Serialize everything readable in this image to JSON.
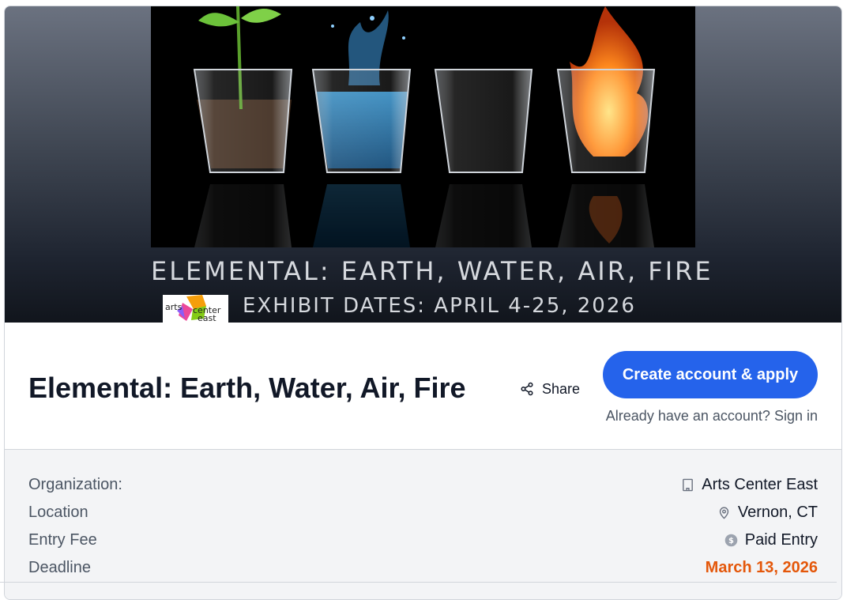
{
  "hero": {
    "poster_title": "ELEMENTAL: EARTH, WATER, AIR, FIRE",
    "poster_dates": "EXHIBIT DATES: APRIL 4-25, 2026",
    "logo_words": [
      "arts",
      "center",
      "east"
    ]
  },
  "header": {
    "title": "Elemental: Earth, Water, Air, Fire",
    "share_label": "Share",
    "cta_label": "Create account & apply",
    "signin_prefix": "Already have an account?",
    "signin_link": "Sign in"
  },
  "details": {
    "rows": [
      {
        "label": "Organization:",
        "value": "Arts Center East",
        "icon": "building-icon"
      },
      {
        "label": "Location",
        "value": "Vernon, CT",
        "icon": "map-pin-icon"
      },
      {
        "label": "Entry Fee",
        "value": "Paid Entry",
        "icon": "dollar-icon"
      },
      {
        "label": "Deadline",
        "value": "March 13, 2026",
        "icon": "",
        "color": "#e4570a"
      }
    ]
  },
  "colors": {
    "accent": "#2563eb",
    "deadline": "#e4570a",
    "details_bg": "#f3f4f6"
  }
}
